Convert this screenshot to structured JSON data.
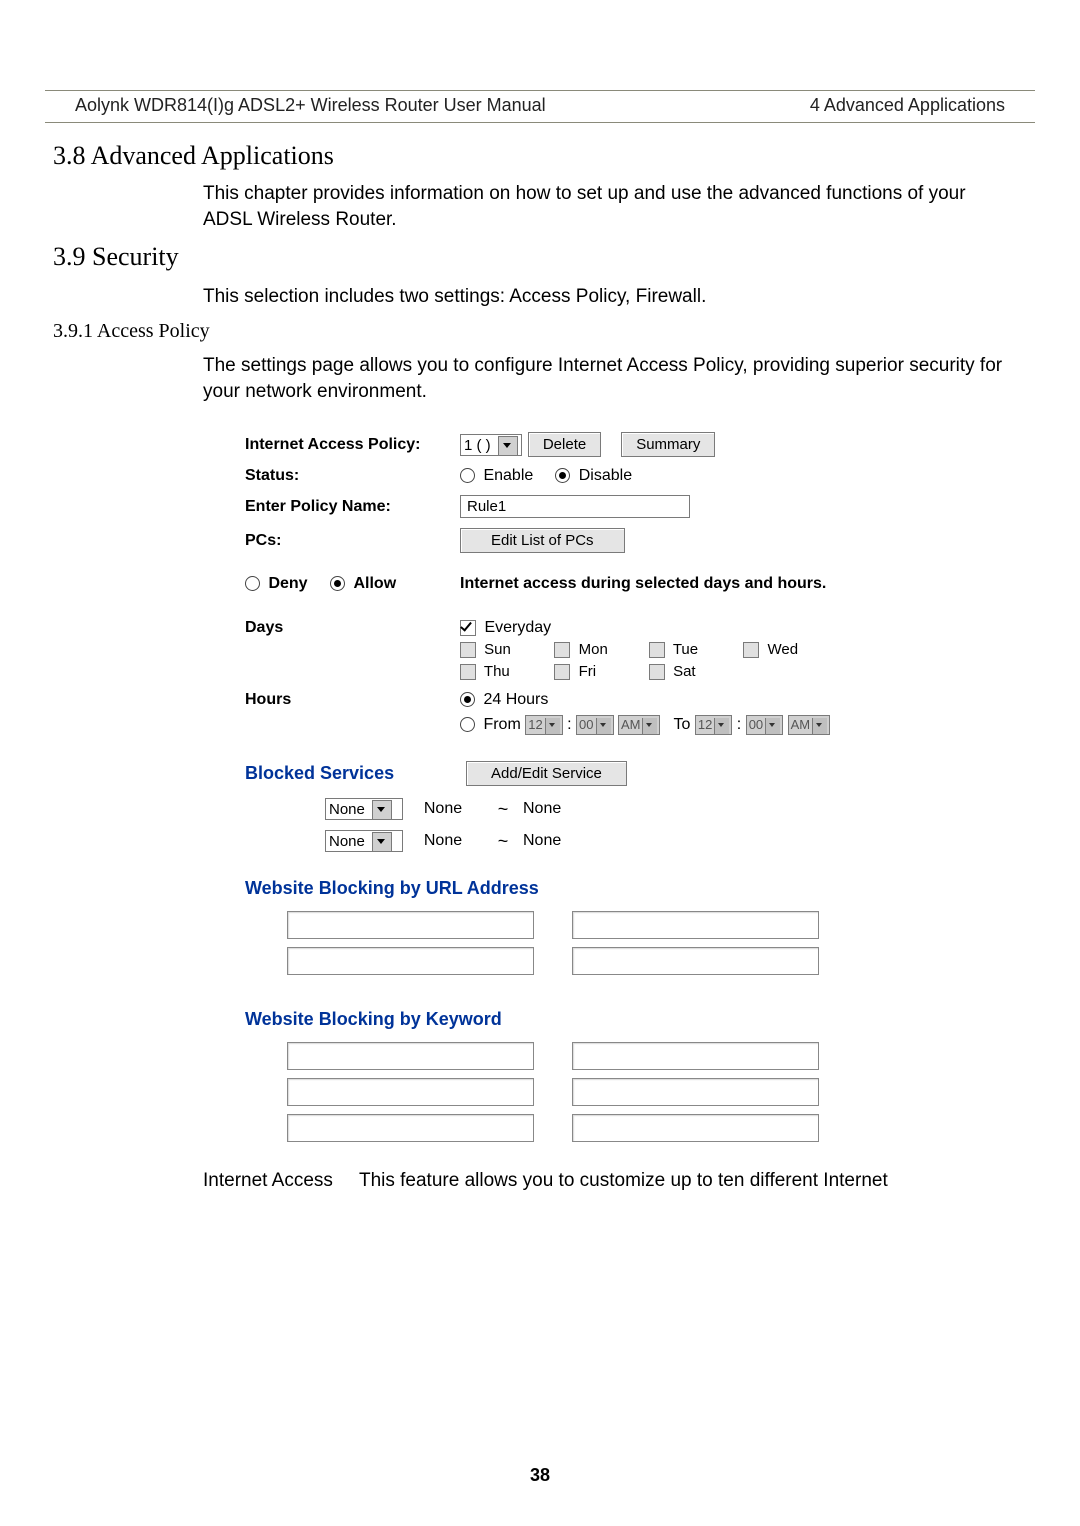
{
  "header": {
    "left": "Aolynk WDR814(I)g ADSL2+ Wireless Router User Manual",
    "right": "4 Advanced Applications"
  },
  "section38": {
    "title": "3.8  Advanced Applications",
    "body": "This chapter provides information on how to set up and use the advanced functions of your ADSL Wireless Router."
  },
  "section39": {
    "title": "3.9  Security",
    "body": "This selection includes two settings: Access Policy, Firewall."
  },
  "section391": {
    "title": "3.9.1  Access Policy",
    "body": "The settings page allows you to configure Internet Access Policy, providing superior security for your network environment."
  },
  "form": {
    "iap_label": "Internet Access Policy:",
    "iap_value": "1 ( )",
    "delete_btn": "Delete",
    "summary_btn": "Summary",
    "status_label": "Status:",
    "status_enable": "Enable",
    "status_disable": "Disable",
    "policy_name_label": "Enter Policy Name:",
    "policy_name_value": "Rule1",
    "pcs_label": "PCs:",
    "pcs_btn": "Edit List of PCs",
    "deny_label": "Deny",
    "allow_label": "Allow",
    "access_note": "Internet access during selected days and hours.",
    "days_label": "Days",
    "everyday": "Everyday",
    "days": {
      "sun": "Sun",
      "mon": "Mon",
      "tue": "Tue",
      "wed": "Wed",
      "thu": "Thu",
      "fri": "Fri",
      "sat": "Sat"
    },
    "hours_label": "Hours",
    "h24": "24 Hours",
    "from_label": "From",
    "to_label": "To",
    "time_h": "12",
    "time_m": "00",
    "time_ampm": "AM",
    "blocked_services": "Blocked Services",
    "add_edit_btn": "Add/Edit Service",
    "none": "None",
    "url_heading": "Website Blocking by URL Address",
    "keyword_heading": "Website Blocking by Keyword"
  },
  "footer": {
    "lead": "Internet Access",
    "rest": "This feature allows you to customize up to ten different Internet"
  },
  "page_number": "38"
}
